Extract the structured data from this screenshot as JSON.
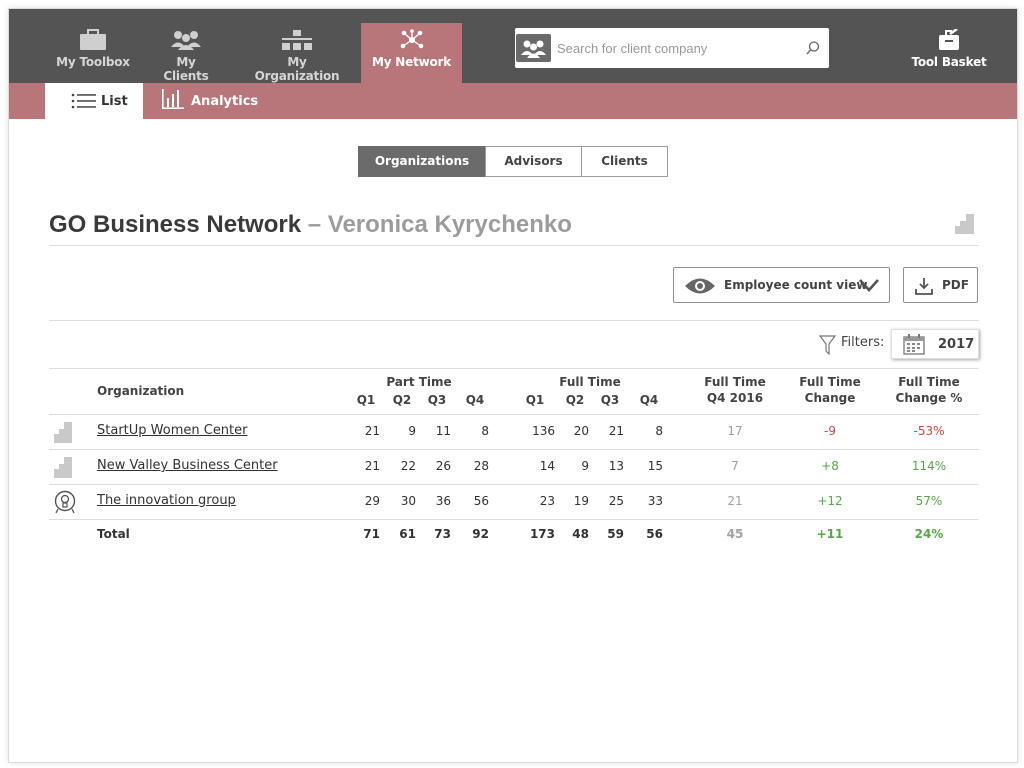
{
  "nav": {
    "toolbox": "My Toolbox",
    "clients": "My Clients",
    "organization": "My Organization",
    "network": "My Network",
    "basket": "Tool Basket"
  },
  "search": {
    "placeholder": "Search for client company"
  },
  "subtabs": {
    "list": "List",
    "analytics": "Analytics"
  },
  "segments": {
    "organizations": "Organizations",
    "advisors": "Advisors",
    "clients": "Clients"
  },
  "heading": {
    "title": "GO Business Network",
    "dash": " – ",
    "person": "Veronica Kyrychenko"
  },
  "view_button": "Employee count view",
  "pdf_button": "PDF",
  "filters_label": "Filters:",
  "year": "2017",
  "table": {
    "headers": {
      "organization": "Organization",
      "part_time": "Part Time",
      "full_time": "Full Time",
      "q1": "Q1",
      "q2": "Q2",
      "q3": "Q3",
      "q4": "Q4",
      "ft_q4_2016": [
        "Full Time",
        "Q4 2016"
      ],
      "ft_change": [
        "Full Time",
        "Change"
      ],
      "ft_change_pct": [
        "Full Time",
        "Change %"
      ]
    },
    "rows": [
      {
        "name": "StartUp Women Center",
        "pt": [
          "21",
          "9",
          "11",
          "8"
        ],
        "ft": [
          "136",
          "20",
          "21",
          "8"
        ],
        "q4_2016": "17",
        "change": "-9",
        "change_pct": "-53%"
      },
      {
        "name": "New Valley Business Center",
        "pt": [
          "21",
          "22",
          "26",
          "28"
        ],
        "ft": [
          "14",
          "9",
          "13",
          "15"
        ],
        "q4_2016": "7",
        "change": "+8",
        "change_pct": "114%"
      },
      {
        "name": "The innovation group",
        "pt": [
          "29",
          "30",
          "36",
          "56"
        ],
        "ft": [
          "23",
          "19",
          "25",
          "33"
        ],
        "q4_2016": "21",
        "change": "+12",
        "change_pct": "57%"
      }
    ],
    "total": {
      "label": "Total",
      "pt": [
        "71",
        "61",
        "73",
        "92"
      ],
      "ft": [
        "173",
        "48",
        "59",
        "56"
      ],
      "q4_2016": "45",
      "change": "+11",
      "change_pct": "24%"
    }
  },
  "colors": {
    "accent": "#b8757a",
    "topbar": "#545454",
    "negative": "#d64545",
    "positive": "#5aa84a"
  },
  "icons": [
    "toolbox-icon",
    "clients-icon",
    "organization-icon",
    "network-icon",
    "basket-icon",
    "people-icon",
    "search-icon",
    "list-icon",
    "analytics-icon",
    "building-icon",
    "eye-icon",
    "chevron-down-icon",
    "download-icon",
    "filter-icon",
    "calendar-icon",
    "lightbulb-icon"
  ]
}
